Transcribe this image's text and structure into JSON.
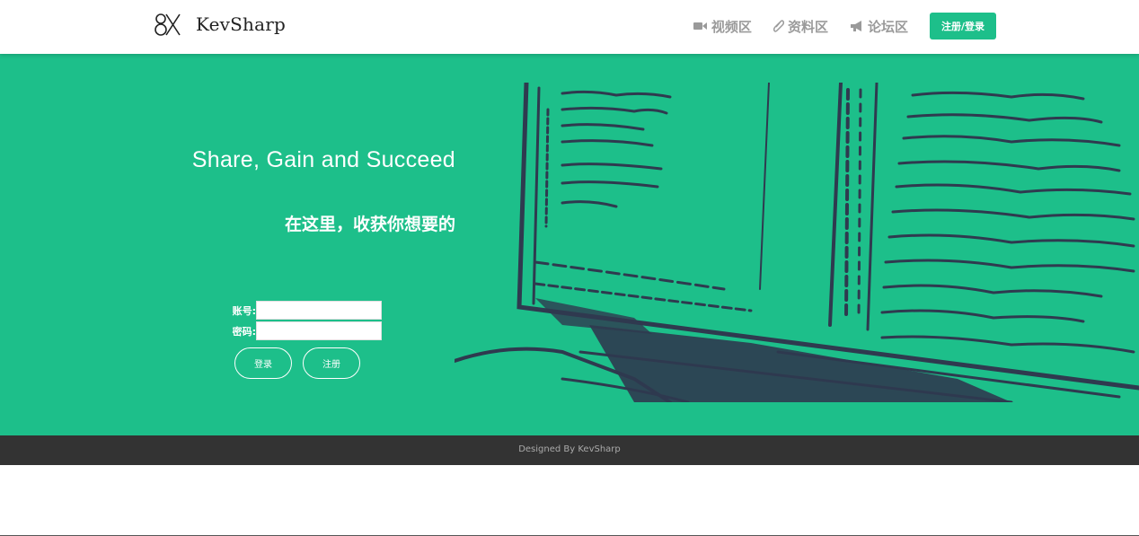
{
  "header": {
    "brand": "KevSharp",
    "nav": [
      {
        "label": "视频区",
        "icon": "video-camera-icon"
      },
      {
        "label": "资料区",
        "icon": "paperclip-icon"
      },
      {
        "label": "论坛区",
        "icon": "megaphone-icon"
      }
    ],
    "auth_button": "注册/登录"
  },
  "hero": {
    "headline": "Share, Gain and Succeed",
    "subheadline": "在这里，收获你想要的",
    "illustration": "laptop-sketch-illustration",
    "form": {
      "account_label": "账号:",
      "account_value": "",
      "password_label": "密码:",
      "password_value": "",
      "login_button": "登录",
      "register_button": "注册"
    }
  },
  "footer": {
    "text": "Designed By KevSharp"
  },
  "colors": {
    "accent": "#1dbf8a",
    "footer_bg": "#333333",
    "nav_text": "#9a9a9a",
    "illustration_ink": "#2f3a4f"
  }
}
